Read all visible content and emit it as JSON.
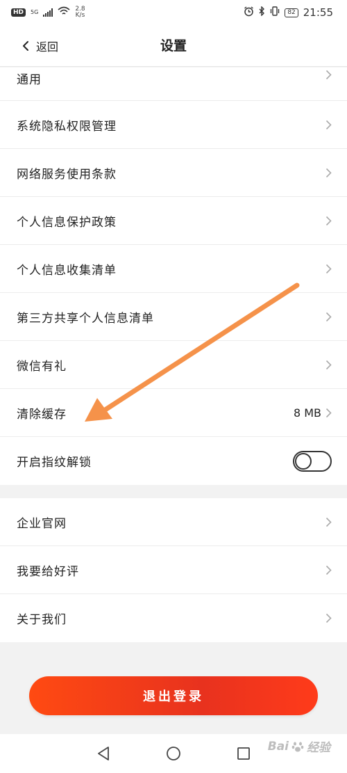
{
  "status_bar": {
    "hd": "HD",
    "network": "5G",
    "speed_value": "2.8",
    "speed_unit": "K/s",
    "battery": "82",
    "time": "21:55"
  },
  "header": {
    "back_label": "返回",
    "title": "设置"
  },
  "group1": {
    "items": [
      {
        "label": "通用"
      },
      {
        "label": "系统隐私权限管理"
      },
      {
        "label": "网络服务使用条款"
      },
      {
        "label": "个人信息保护政策"
      },
      {
        "label": "个人信息收集清单"
      },
      {
        "label": "第三方共享个人信息清单"
      },
      {
        "label": "微信有礼"
      },
      {
        "label": "清除缓存",
        "value": "8 MB"
      },
      {
        "label": "开启指纹解锁",
        "toggle_on": false
      }
    ]
  },
  "group2": {
    "items": [
      {
        "label": "企业官网"
      },
      {
        "label": "我要给好评"
      },
      {
        "label": "关于我们"
      }
    ]
  },
  "logout_label": "退出登录",
  "watermark": {
    "brand_left": "Bai",
    "brand_right": "经验"
  },
  "colors": {
    "logout_gradient_start": "#ff4a12",
    "logout_gradient_end": "#e8321e",
    "annotation_arrow": "#f5924a"
  },
  "icons": {
    "back": "chevron-left-icon",
    "row_arrow": "chevron-right-icon",
    "nav_back": "triangle-back-icon",
    "nav_home": "circle-home-icon",
    "nav_recent": "square-recent-icon"
  }
}
